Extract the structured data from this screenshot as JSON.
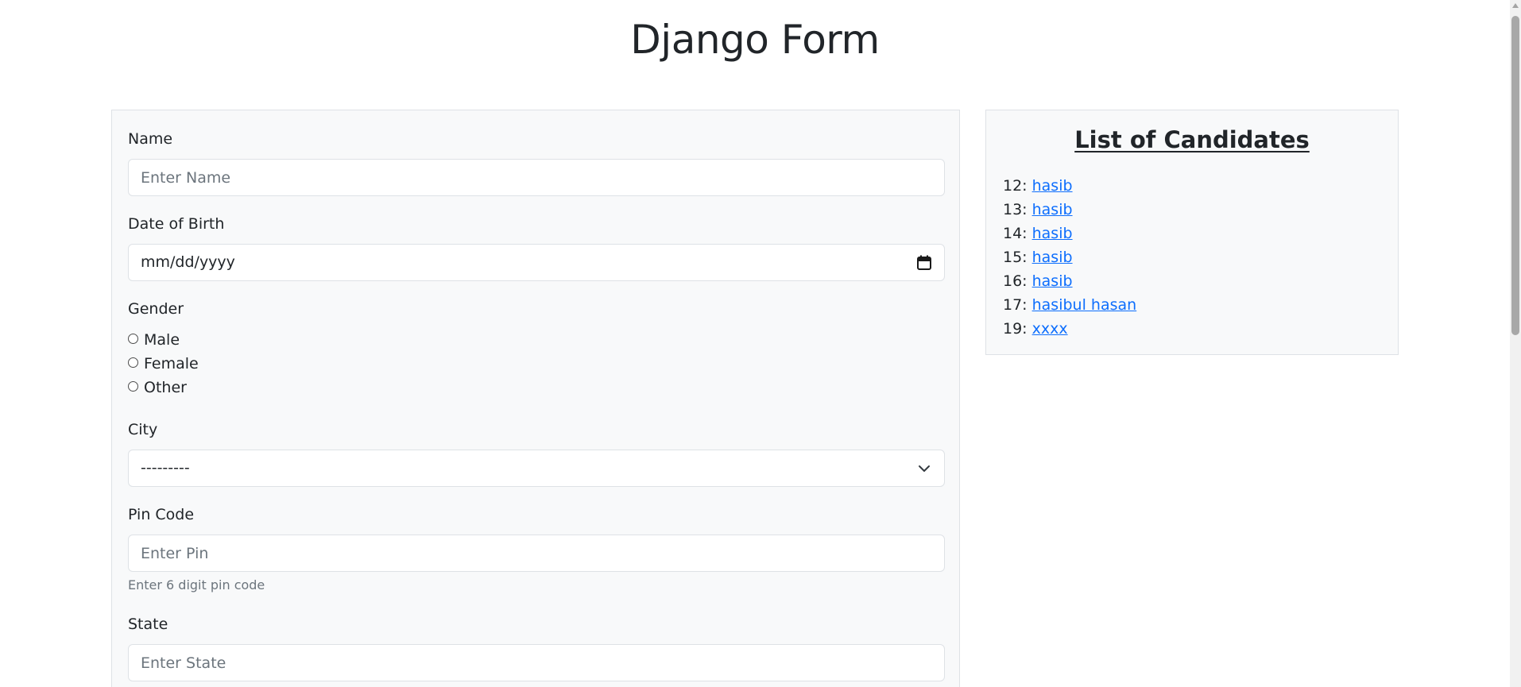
{
  "header": {
    "title": "Django Form"
  },
  "form": {
    "name": {
      "label": "Name",
      "placeholder": "Enter Name",
      "value": ""
    },
    "dob": {
      "label": "Date of Birth",
      "placeholder": "mm/dd/yyyy",
      "icon": "calendar-icon"
    },
    "gender": {
      "label": "Gender",
      "options": [
        {
          "label": "Male",
          "checked": false
        },
        {
          "label": "Female",
          "checked": false
        },
        {
          "label": "Other",
          "checked": false
        }
      ]
    },
    "city": {
      "label": "City",
      "selected": "---------",
      "icon": "chevron-down-icon"
    },
    "pin": {
      "label": "Pin Code",
      "placeholder": "Enter Pin",
      "help": "Enter 6 digit pin code"
    },
    "state": {
      "label": "State",
      "placeholder": "Enter State"
    }
  },
  "candidates": {
    "title": "List of Candidates",
    "items": [
      {
        "id": "12:",
        "name": "hasib"
      },
      {
        "id": "13:",
        "name": "hasib"
      },
      {
        "id": "14:",
        "name": "hasib"
      },
      {
        "id": "15:",
        "name": "hasib"
      },
      {
        "id": "16:",
        "name": "hasib"
      },
      {
        "id": "17:",
        "name": "hasibul hasan"
      },
      {
        "id": "19:",
        "name": "xxxx"
      }
    ]
  },
  "colors": {
    "panel_bg": "#f8f9fa",
    "border": "#dee2e6",
    "link": "#0d6efd",
    "text": "#212529",
    "muted": "#6c757d"
  }
}
